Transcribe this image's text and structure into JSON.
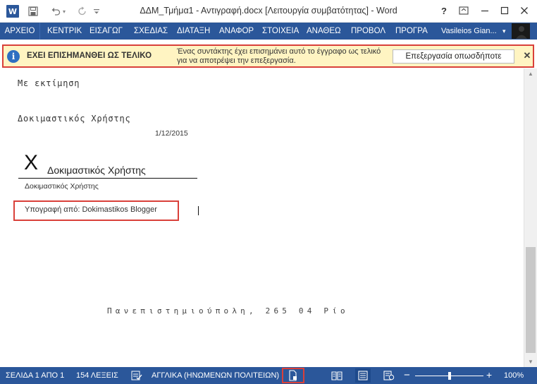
{
  "window": {
    "title": "ΔΔΜ_Τμήμα1 - Αντιγραφή.docx [Λειτουργία συμβατότητας] - Word",
    "app_icon": "W",
    "help": "?",
    "accent_color": "#2b579a"
  },
  "qat": {
    "save_icon": "save-icon",
    "undo_icon": "undo-icon",
    "redo_icon": "redo-icon",
    "customize_icon": "customize-icon"
  },
  "ribbon": {
    "tabs": [
      {
        "label": "ΑΡΧΕΙΟ"
      },
      {
        "label": "ΚΕΝΤΡΙΚ"
      },
      {
        "label": "ΕΙΣΑΓΩΓ"
      },
      {
        "label": "ΣΧΕΔΙΑΣ"
      },
      {
        "label": "ΔΙΑΤΑΞΗ"
      },
      {
        "label": "ΑΝΑΦΟΡ"
      },
      {
        "label": "ΣΤΟΙΧΕΙΑ"
      },
      {
        "label": "ΑΝΑΘΕΩ"
      },
      {
        "label": "ΠΡΟΒΟΛ"
      },
      {
        "label": "ΠΡΟΓΡΑ"
      }
    ],
    "user": "Vasileios Gian...",
    "user_caret": "▾"
  },
  "message_bar": {
    "title": "ΕΧΕΙ ΕΠΙΣΗΜΑΝΘΕΙ ΩΣ ΤΕΛΙΚΟ",
    "text": "Ένας συντάκτης έχει επισημάνει αυτό το έγγραφο ως τελικό για να αποτρέψει την επεξεργασία.",
    "button": "Επεξεργασία οπωσδήποτε",
    "close": "✕",
    "info": "i",
    "highlight_color": "#d9403a",
    "background": "#fff4c2"
  },
  "document": {
    "closing": "Με εκτίμηση",
    "signer_top": "Δοκιμαστικός Χρήστης",
    "date": "1/12/2015",
    "signature": {
      "x_mark": "X",
      "name": "Δοκιμαστικός Χρήστης",
      "caption": "Δοκιμαστικός Χρήστης",
      "signed_by": "Υπογραφή από: Dokimastikos Blogger"
    },
    "footer_address": "Πανεπιστημιούπολη, 265 04 Ρίο"
  },
  "status_bar": {
    "page": "ΣΕΛΙΔΑ 1 ΑΠΟ 1",
    "words": "154 ΛΕΞΕΙΣ",
    "language": "ΑΓΓΛΙΚΑ (ΗΝΩΜΕΝΩΝ ΠΟΛΙΤΕΙΩΝ)",
    "zoom": "100%",
    "zoom_value_percent": 100,
    "zoom_minus": "−",
    "zoom_plus": "+"
  }
}
